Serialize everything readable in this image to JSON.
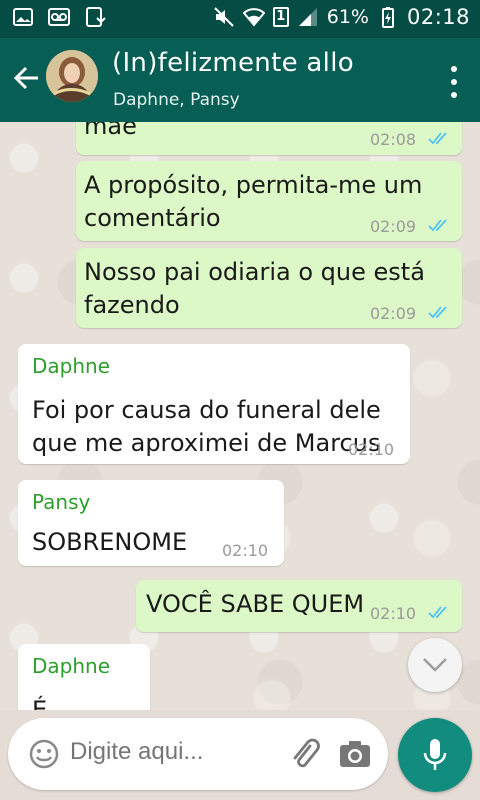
{
  "status_bar": {
    "battery_percent": "61%",
    "time": "02:18",
    "sim_label": "1",
    "icons": [
      "image-icon",
      "voicemail-icon",
      "download-icon",
      "mute-icon",
      "wifi-icon",
      "signal-icon",
      "battery-charging-icon"
    ]
  },
  "header": {
    "title": "(In)felizmente allo",
    "subtitle": "Daphne, Pansy",
    "icons": [
      "back-arrow-icon",
      "avatar",
      "more-vert-icon"
    ]
  },
  "messages": [
    {
      "direction": "out",
      "text_lines": [
        "mãe"
      ],
      "time": "02:08",
      "status": "read"
    },
    {
      "direction": "out",
      "text_lines": [
        "A propósito, permita-me um",
        "comentário"
      ],
      "time": "02:09",
      "status": "read"
    },
    {
      "direction": "out",
      "text_lines": [
        "Nosso pai odiaria o que está",
        "fazendo"
      ],
      "time": "02:09",
      "status": "read"
    },
    {
      "direction": "in",
      "sender": "Daphne",
      "text_lines": [
        "Foi por causa do funeral dele",
        "que me aproximei de Marcus"
      ],
      "time": "02:10"
    },
    {
      "direction": "in",
      "sender": "Pansy",
      "text_lines": [
        "SOBRENOME"
      ],
      "time": "02:10"
    },
    {
      "direction": "out",
      "text_lines": [
        "VOCÊ SABE QUEM"
      ],
      "time": "02:10",
      "status": "read"
    },
    {
      "direction": "in",
      "sender": "Daphne",
      "text_lines": [
        "É"
      ],
      "time": ""
    }
  ],
  "input": {
    "placeholder": "Digite aqui...",
    "icons": [
      "emoji-icon",
      "paperclip-icon",
      "camera-icon",
      "mic-icon",
      "chevron-down-icon"
    ]
  },
  "colors": {
    "status_bar": "#054d44",
    "header": "#075e54",
    "outgoing_bubble": "#dcf8c6",
    "incoming_bubble": "#ffffff",
    "sender_name": "#2e9e2e",
    "read_ticks": "#4fc3f7",
    "mic_button": "#128c7e"
  }
}
